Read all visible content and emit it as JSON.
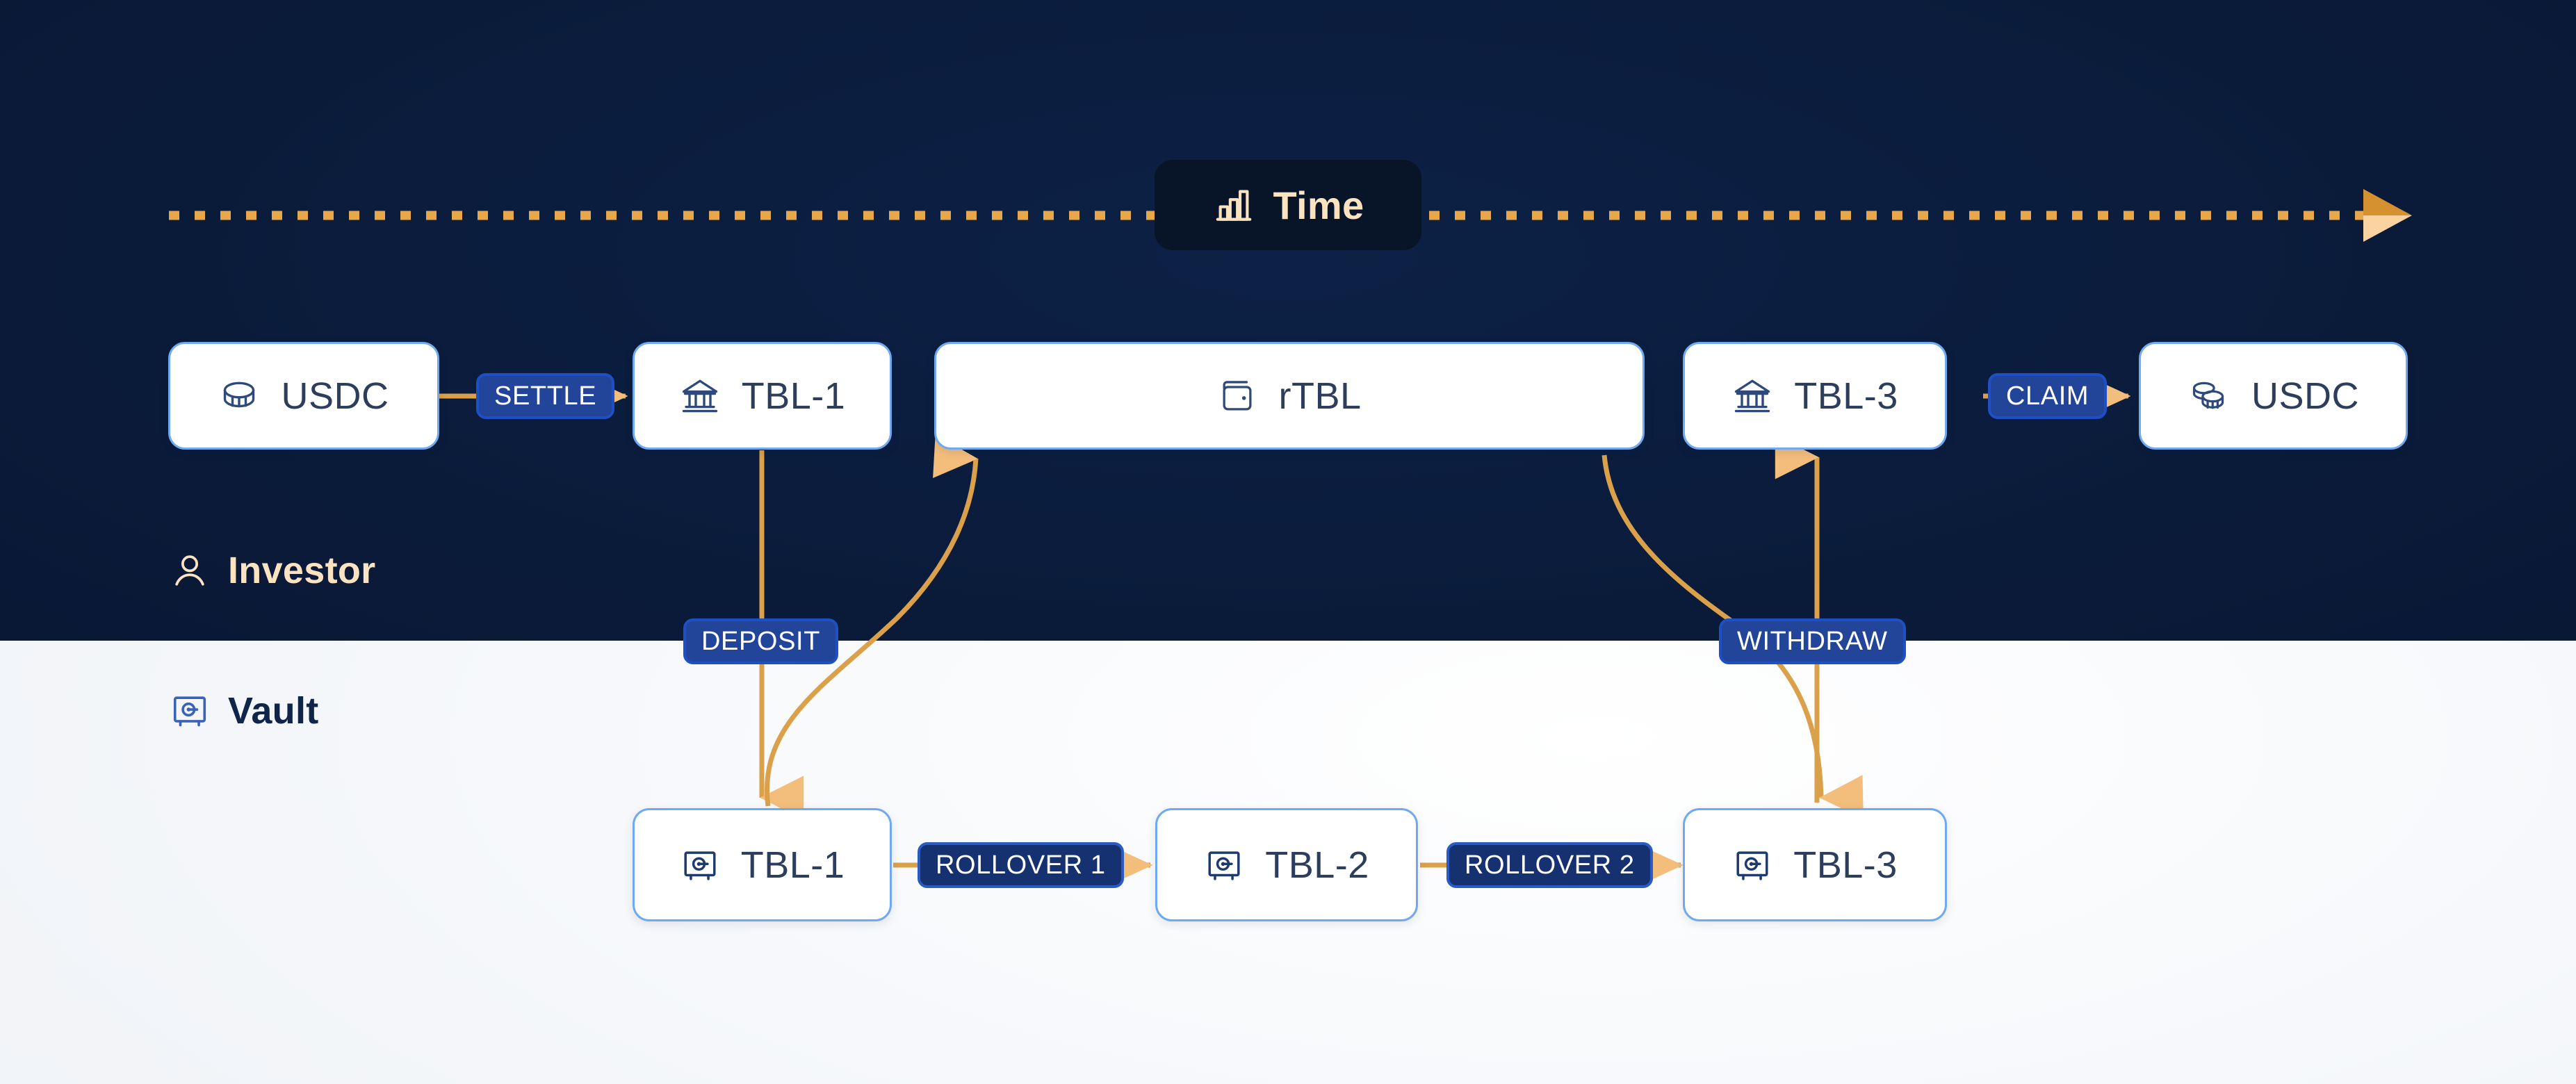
{
  "timeline": {
    "badge_label": "Time",
    "badge_icon": "bar-chart-icon",
    "direction": "left-to-right",
    "line_style": "dotted",
    "line_color": "#e8a84a",
    "arrow_color": "#f6c784"
  },
  "lanes": [
    {
      "id": "investor",
      "label": "Investor",
      "icon": "person-icon",
      "text_color": "#fbe3c2"
    },
    {
      "id": "vault",
      "label": "Vault",
      "icon": "vault-icon",
      "text_color": "#0f2549"
    }
  ],
  "investor_row": {
    "nodes": [
      {
        "id": "usdc-in",
        "label": "USDC",
        "icon": "coin-icon"
      },
      {
        "id": "tbl1-top",
        "label": "TBL-1",
        "icon": "bank-icon"
      },
      {
        "id": "rtbl",
        "label": "rTBL",
        "icon": "wallet-icon"
      },
      {
        "id": "tbl3-top",
        "label": "TBL-3",
        "icon": "bank-icon"
      },
      {
        "id": "usdc-out",
        "label": "USDC",
        "icon": "coins-stack-icon"
      }
    ],
    "badges": [
      {
        "id": "settle",
        "label": "SETTLE",
        "style": "mid"
      },
      {
        "id": "claim",
        "label": "CLAIM",
        "style": "mid"
      }
    ]
  },
  "vault_row": {
    "nodes": [
      {
        "id": "tbl1-bottom",
        "label": "TBL-1",
        "icon": "vault-icon"
      },
      {
        "id": "tbl2-bottom",
        "label": "TBL-2",
        "icon": "vault-icon"
      },
      {
        "id": "tbl3-bottom",
        "label": "TBL-3",
        "icon": "vault-icon"
      }
    ],
    "badges": [
      {
        "id": "rollover-1",
        "label": "ROLLOVER 1",
        "style": "deep"
      },
      {
        "id": "rollover-2",
        "label": "ROLLOVER 2",
        "style": "deep"
      }
    ]
  },
  "cross_lane_badges": [
    {
      "id": "deposit",
      "label": "DEPOSIT",
      "style": "mid"
    },
    {
      "id": "withdraw",
      "label": "WITHDRAW",
      "style": "mid"
    }
  ],
  "colors": {
    "dark_band": "#0a1a38",
    "light_band": "#f3f5f9",
    "node_border": "#70a9f0",
    "node_text": "#2c3e5c",
    "badge_mid": "#22459a",
    "badge_deep": "#16316f",
    "connector": "#d99733",
    "arrowhead": "#f6c784",
    "cream": "#fbe3c2"
  }
}
